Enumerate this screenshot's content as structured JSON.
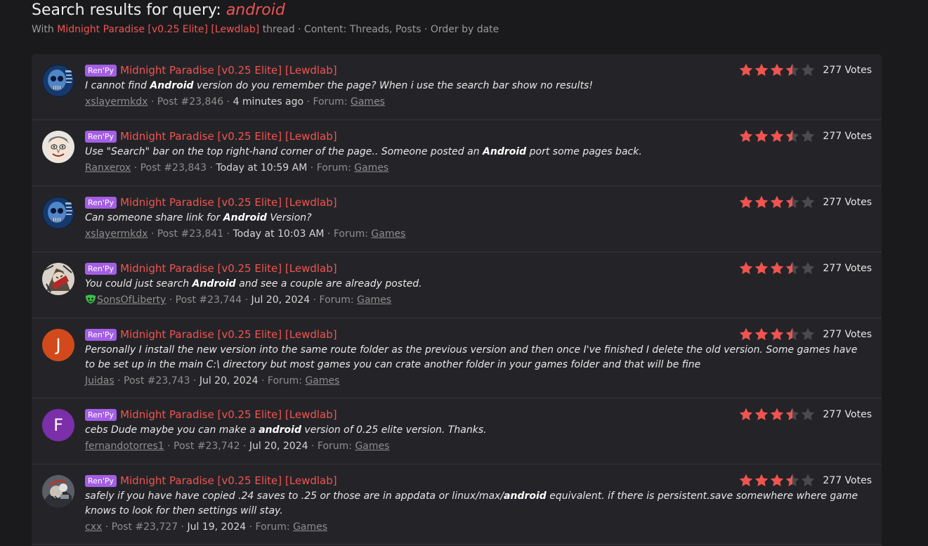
{
  "search": {
    "title_prefix": "Search results for query: ",
    "query": "android",
    "with_label": "With",
    "thread_name": "Midnight Paradise [v0.25 Elite] [Lewdlab]",
    "filters": "thread · Content: Threads, Posts · Order by date"
  },
  "colors": {
    "accent": "#f0544f",
    "prefix_bg": "#a45ee5",
    "star_empty": "#4a4a4f"
  },
  "results": [
    {
      "prefix": "Ren'Py",
      "thread_title": "Midnight Paradise [v0.25 Elite] [Lewdlab]",
      "snippet_before": "I cannot find ",
      "snippet_match": "Android",
      "snippet_after": " version do you remember the page? When i use the search bar show no results!",
      "username": "xslayermkdx",
      "post": "Post #23,846",
      "date": "4 minutes ago",
      "forum_label": "Forum:",
      "forum": "Games",
      "rating": 3.5,
      "votes": "277 Votes",
      "avatar": "skull-avatar",
      "avatar_letter": ""
    },
    {
      "prefix": "Ren'Py",
      "thread_title": "Midnight Paradise [v0.25 Elite] [Lewdlab]",
      "snippet_before": "Use \"Search\" bar on the top right-hand corner of the page.. Someone posted an ",
      "snippet_match": "Android",
      "snippet_after": " port some pages back.",
      "username": "Ranxerox",
      "post": "Post #23,843",
      "date": "Today at 10:59 AM",
      "forum_label": "Forum:",
      "forum": "Games",
      "rating": 3.5,
      "votes": "277 Votes",
      "avatar": "face-avatar",
      "avatar_letter": ""
    },
    {
      "prefix": "Ren'Py",
      "thread_title": "Midnight Paradise [v0.25 Elite] [Lewdlab]",
      "snippet_before": "Can someone share link for ",
      "snippet_match": "Android",
      "snippet_after": " Version?",
      "username": "xslayermkdx",
      "post": "Post #23,841",
      "date": "Today at 10:03 AM",
      "forum_label": "Forum:",
      "forum": "Games",
      "rating": 3.5,
      "votes": "277 Votes",
      "avatar": "skull-avatar",
      "avatar_letter": ""
    },
    {
      "prefix": "Ren'Py",
      "thread_title": "Midnight Paradise [v0.25 Elite] [Lewdlab]",
      "snippet_before": "You could just search ",
      "snippet_match": "Android",
      "snippet_after": " and see a couple are already posted.",
      "username": "SonsOfLiberty",
      "user_badge": "mask-icon",
      "post": "Post #23,744",
      "date": "Jul 20, 2024",
      "forum_label": "Forum:",
      "forum": "Games",
      "rating": 3.5,
      "votes": "277 Votes",
      "avatar": "sketch-avatar",
      "avatar_letter": ""
    },
    {
      "prefix": "Ren'Py",
      "thread_title": "Midnight Paradise [v0.25 Elite] [Lewdlab]",
      "snippet_before": "Personally I install the new version into the same route folder as the previous version and then once I've finished I delete the old version. Some games have to be set up in the main C:\\ directory but most games you can crate another folder in your games folder and that will be fine",
      "snippet_match": "",
      "snippet_after": "",
      "username": "Juidas",
      "post": "Post #23,743",
      "date": "Jul 20, 2024",
      "forum_label": "Forum:",
      "forum": "Games",
      "rating": 3.5,
      "votes": "277 Votes",
      "avatar": "letter-avatar",
      "avatar_letter": "J",
      "avatar_color": "#d24a1c"
    },
    {
      "prefix": "Ren'Py",
      "thread_title": "Midnight Paradise [v0.25 Elite] [Lewdlab]",
      "snippet_before": "cebs Dude maybe you can make a ",
      "snippet_match": "android",
      "snippet_after": " version of 0.25 elite version. Thanks.",
      "username": "fernandotorres1",
      "post": "Post #23,742",
      "date": "Jul 20, 2024",
      "forum_label": "Forum:",
      "forum": "Games",
      "rating": 3.5,
      "votes": "277 Votes",
      "avatar": "letter-avatar",
      "avatar_letter": "F",
      "avatar_color": "#7b2fa8"
    },
    {
      "prefix": "Ren'Py",
      "thread_title": "Midnight Paradise [v0.25 Elite] [Lewdlab]",
      "snippet_before": "safely if you have have copied .24 saves to .25 or those are in appdata or linux/max/",
      "snippet_match": "android",
      "snippet_after": " equivalent. if there is persistent.save somewhere where game knows to look for then settings will stay.",
      "username": "cxx",
      "post": "Post #23,727",
      "date": "Jul 19, 2024",
      "forum_label": "Forum:",
      "forum": "Games",
      "rating": 3.5,
      "votes": "277 Votes",
      "avatar": "mech-avatar",
      "avatar_letter": ""
    }
  ]
}
